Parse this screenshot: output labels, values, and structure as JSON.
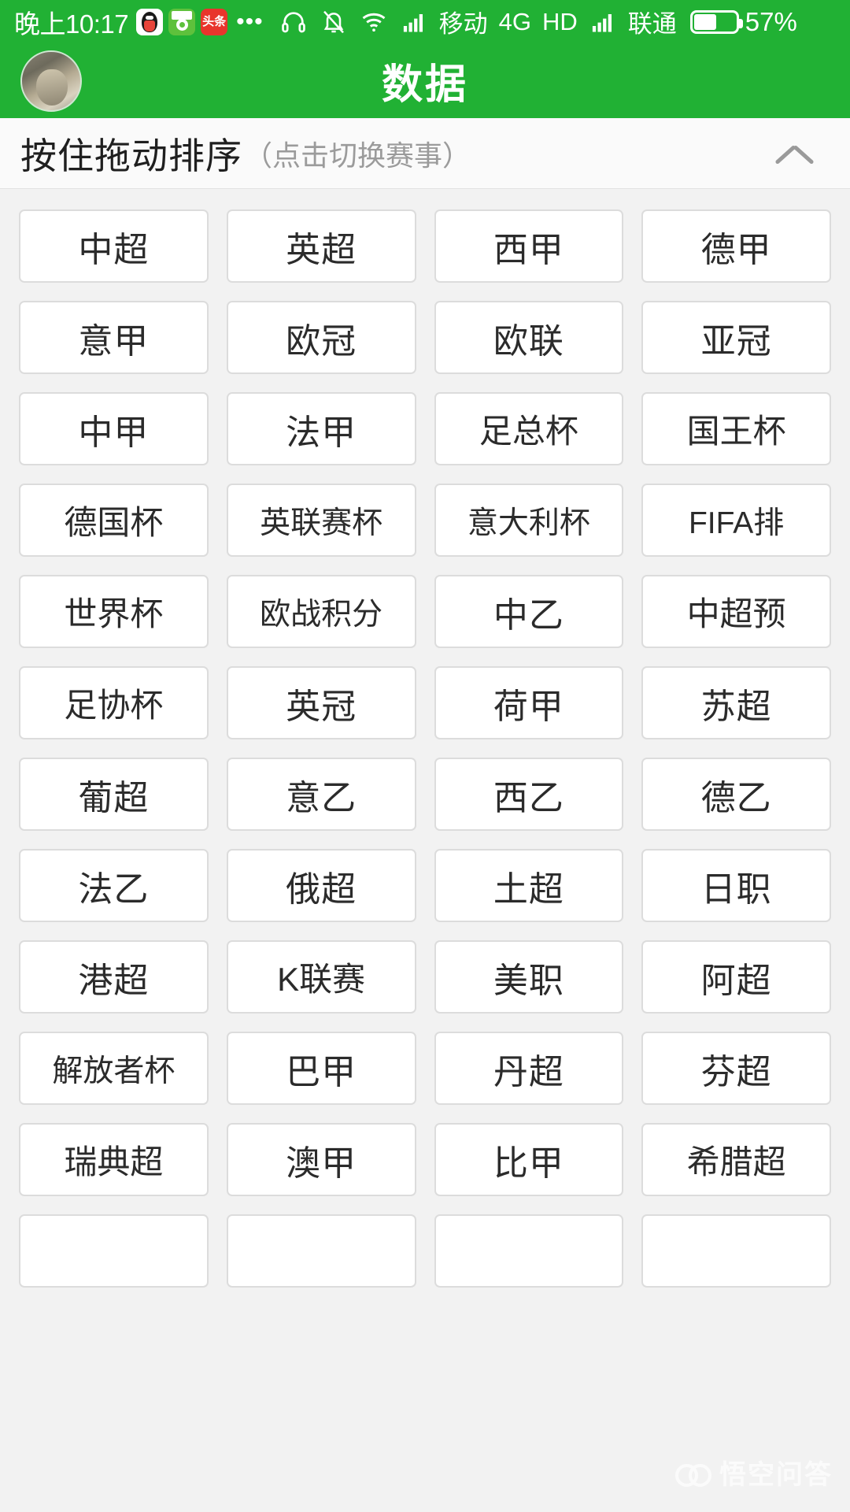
{
  "status_bar": {
    "time": "晚上10:17",
    "app_icons": [
      "qq-icon",
      "green-app-icon",
      "toutiao-icon"
    ],
    "toutiao_label": "头条",
    "overflow_dots": "•••",
    "icons": [
      "headset-icon",
      "bell-muted-icon",
      "wifi-icon",
      "signal-bars-icon",
      "signal-bars-icon-2"
    ],
    "carrier_primary": "移动",
    "network_type": "4G",
    "hd_label": "HD",
    "carrier_secondary": "联通",
    "battery_percent": "57%",
    "battery_level": 57,
    "background_color": "#21b134",
    "text_color": "#ffffff"
  },
  "header": {
    "title": "数据",
    "avatar": "user-avatar",
    "background_color": "#21b134"
  },
  "sort_bar": {
    "main_label": "按住拖动排序",
    "sub_label": "（点击切换赛事）",
    "collapse_icon": "chevron-up-icon"
  },
  "grid": {
    "columns": 4,
    "leagues": [
      "中超",
      "英超",
      "西甲",
      "德甲",
      "意甲",
      "欧冠",
      "欧联",
      "亚冠",
      "中甲",
      "法甲",
      "足总杯",
      "国王杯",
      "德国杯",
      "英联赛杯",
      "意大利杯",
      "FIFA排",
      "世界杯",
      "欧战积分",
      "中乙",
      "中超预",
      "足协杯",
      "英冠",
      "荷甲",
      "苏超",
      "葡超",
      "意乙",
      "西乙",
      "德乙",
      "法乙",
      "俄超",
      "土超",
      "日职",
      "港超",
      "K联赛",
      "美职",
      "阿超",
      "解放者杯",
      "巴甲",
      "丹超",
      "芬超",
      "瑞典超",
      "澳甲",
      "比甲",
      "希腊超",
      "",
      "",
      "",
      ""
    ]
  },
  "watermark": {
    "text": "悟空问答",
    "logo": "wukong-owl-logo"
  }
}
